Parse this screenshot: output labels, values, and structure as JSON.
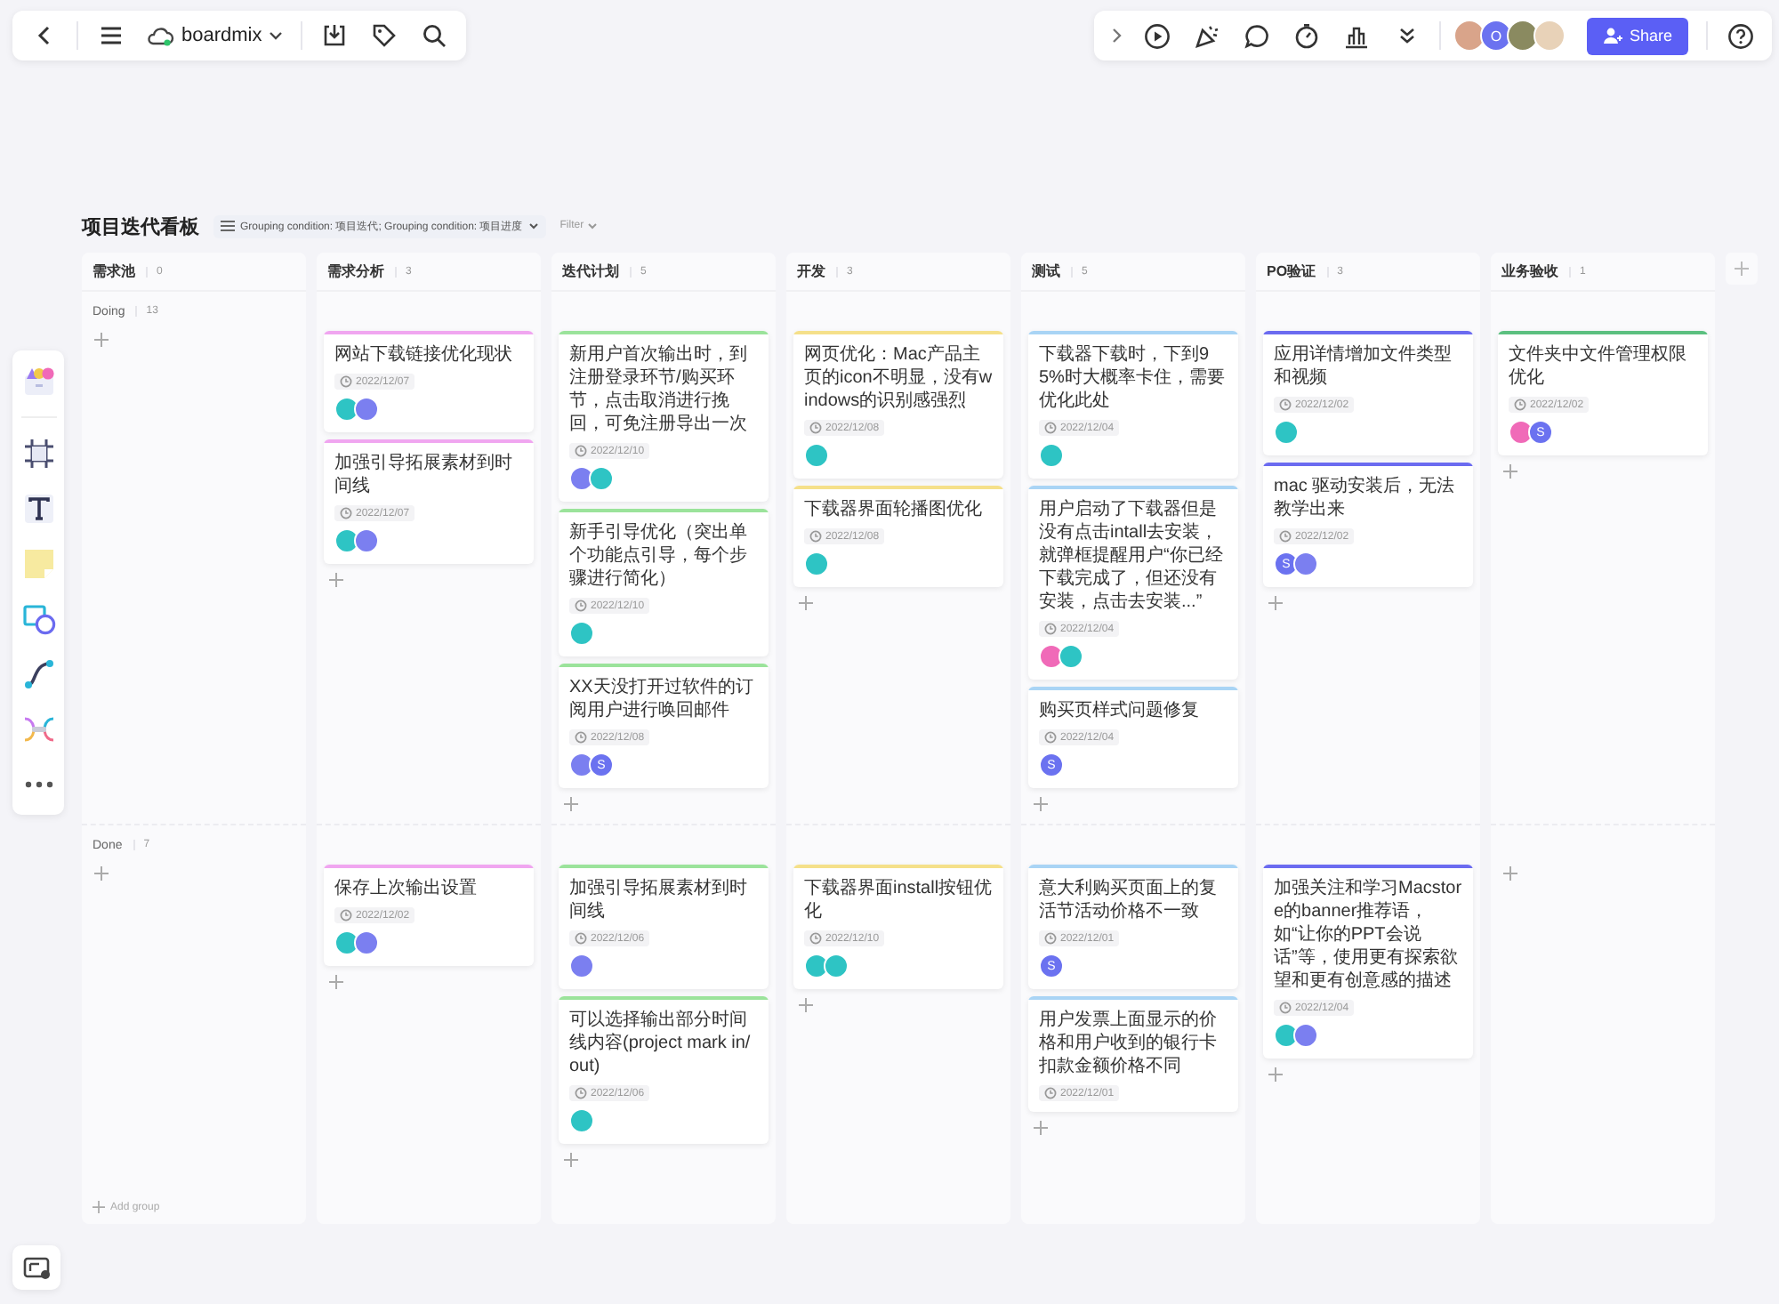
{
  "top_bar": {
    "brand": "boardmix",
    "share": "Share",
    "avatars": [
      {
        "color": "#d9a48a"
      },
      {
        "color": "#6b72f0",
        "label": "O"
      },
      {
        "color": "#8a8a60"
      },
      {
        "color": "#e8d2b8"
      }
    ]
  },
  "board": {
    "title": "项目迭代看板",
    "grouping": "Grouping condition: 项目迭代; Grouping condition: 项目进度",
    "filter": "Filter",
    "add_group": "Add group",
    "lanes": [
      {
        "label": "Doing",
        "count": "13"
      },
      {
        "label": "Done",
        "count": "7"
      }
    ],
    "columns": [
      {
        "name": "需求池",
        "count": "0"
      },
      {
        "name": "需求分析",
        "count": "3",
        "color": "#f0a6f0",
        "doing": [
          {
            "title": "网站下载链接优化现状",
            "date": "2022/12/07",
            "assignees": [
              {
                "color": "#2ec4c4"
              },
              {
                "color": "#7b7ff0"
              }
            ]
          },
          {
            "title": "加强引导拓展素材到时间线",
            "date": "2022/12/07",
            "assignees": [
              {
                "color": "#2ec4c4"
              },
              {
                "color": "#7b7ff0"
              }
            ]
          }
        ],
        "done": [
          {
            "title": "保存上次输出设置",
            "date": "2022/12/02",
            "assignees": [
              {
                "color": "#2ec4c4"
              },
              {
                "color": "#7b7ff0"
              }
            ]
          }
        ]
      },
      {
        "name": "迭代计划",
        "count": "5",
        "color": "#9be39b",
        "doing": [
          {
            "title": "新用户首次输出时，到注册登录环节/购买环节，点击取消进行挽回，可免注册导出一次",
            "date": "2022/12/10",
            "assignees": [
              {
                "color": "#7b7ff0"
              },
              {
                "color": "#2ec4c4"
              }
            ]
          },
          {
            "title": "新手引导优化（突出单个功能点引导，每个步骤进行简化）",
            "date": "2022/12/10",
            "assignees": [
              {
                "color": "#2ec4c4"
              }
            ]
          },
          {
            "title": "XX天没打开过软件的订阅用户进行唤回邮件",
            "date": "2022/12/08",
            "assignees": [
              {
                "color": "#7b7ff0"
              },
              {
                "color": "#6b72f0",
                "label": "S"
              }
            ]
          }
        ],
        "done": [
          {
            "title": "加强引导拓展素材到时间线",
            "date": "2022/12/06",
            "assignees": [
              {
                "color": "#7b7ff0"
              }
            ]
          },
          {
            "title": "可以选择输出部分时间线内容(project mark in/out)",
            "date": "2022/12/06",
            "assignees": [
              {
                "color": "#2ec4c4"
              }
            ]
          }
        ]
      },
      {
        "name": "开发",
        "count": "3",
        "color": "#f5e08a",
        "doing": [
          {
            "title": "网页优化：Mac产品主页的icon不明显，没有windows的识别感强烈",
            "date": "2022/12/08",
            "assignees": [
              {
                "color": "#2ec4c4"
              }
            ]
          },
          {
            "title": "下载器界面轮播图优化",
            "date": "2022/12/08",
            "assignees": [
              {
                "color": "#2ec4c4"
              }
            ]
          }
        ],
        "done": [
          {
            "title": "下载器界面install按钮优化",
            "date": "2022/12/10",
            "assignees": [
              {
                "color": "#2ec4c4"
              },
              {
                "color": "#2ec4c4"
              }
            ]
          }
        ]
      },
      {
        "name": "测试",
        "count": "5",
        "color": "#a9d4f5",
        "doing": [
          {
            "title": "下载器下载时，下到95%时大概率卡住，需要优化此处",
            "date": "2022/12/04",
            "assignees": [
              {
                "color": "#2ec4c4"
              }
            ]
          },
          {
            "title": "用户启动了下载器但是没有点击intall去安装，就弹框提醒用户“你已经下载完成了，但还没有安装，点击去安装...”",
            "date": "2022/12/04",
            "assignees": [
              {
                "color": "#f06ab8"
              },
              {
                "color": "#2ec4c4"
              }
            ]
          },
          {
            "title": "购买页样式问题修复",
            "date": "2022/12/04",
            "assignees": [
              {
                "color": "#6b72f0",
                "label": "S"
              }
            ]
          }
        ],
        "done": [
          {
            "title": "意大利购买页面上的复活节活动价格不一致",
            "date": "2022/12/01",
            "assignees": [
              {
                "color": "#6b72f0",
                "label": "S"
              }
            ]
          },
          {
            "title": "用户发票上面显示的价格和用户收到的银行卡扣款金额价格不同",
            "date": "2022/12/01"
          }
        ]
      },
      {
        "name": "PO验证",
        "count": "3",
        "color": "#6b6bf0",
        "doing": [
          {
            "title": "应用详情增加文件类型和视频",
            "date": "2022/12/02",
            "assignees": [
              {
                "color": "#2ec4c4"
              }
            ]
          },
          {
            "title": "mac 驱动安装后，无法教学出来",
            "date": "2022/12/02",
            "assignees": [
              {
                "color": "#6b72f0",
                "label": "S"
              },
              {
                "color": "#7b7ff0"
              }
            ]
          }
        ],
        "done": [
          {
            "title": "加强关注和学习Macstore的banner推荐语，如“让你的PPT会说话”等，使用更有探索欲望和更有创意感的描述",
            "date": "2022/12/04",
            "assignees": [
              {
                "color": "#2ec4c4"
              },
              {
                "color": "#7b7ff0"
              }
            ]
          }
        ]
      },
      {
        "name": "业务验收",
        "count": "1",
        "color": "#5cc080",
        "doing": [
          {
            "title": "文件夹中文件管理权限优化",
            "date": "2022/12/02",
            "assignees": [
              {
                "color": "#f06ab8"
              },
              {
                "color": "#6b72f0",
                "label": "S"
              }
            ]
          }
        ]
      }
    ]
  }
}
